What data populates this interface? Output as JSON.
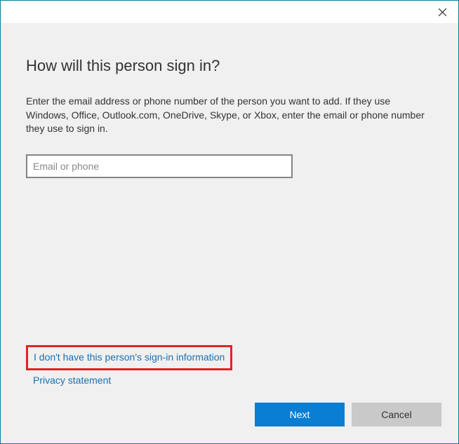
{
  "dialog": {
    "title": "How will this person sign in?",
    "description": "Enter the email address or phone number of the person you want to add. If they use Windows, Office, Outlook.com, OneDrive, Skype, or Xbox, enter the email or phone number they use to sign in.",
    "input": {
      "placeholder": "Email or phone",
      "value": ""
    },
    "links": {
      "no_info": "I don't have this person's sign-in information",
      "privacy": "Privacy statement"
    },
    "buttons": {
      "next": "Next",
      "cancel": "Cancel"
    }
  }
}
